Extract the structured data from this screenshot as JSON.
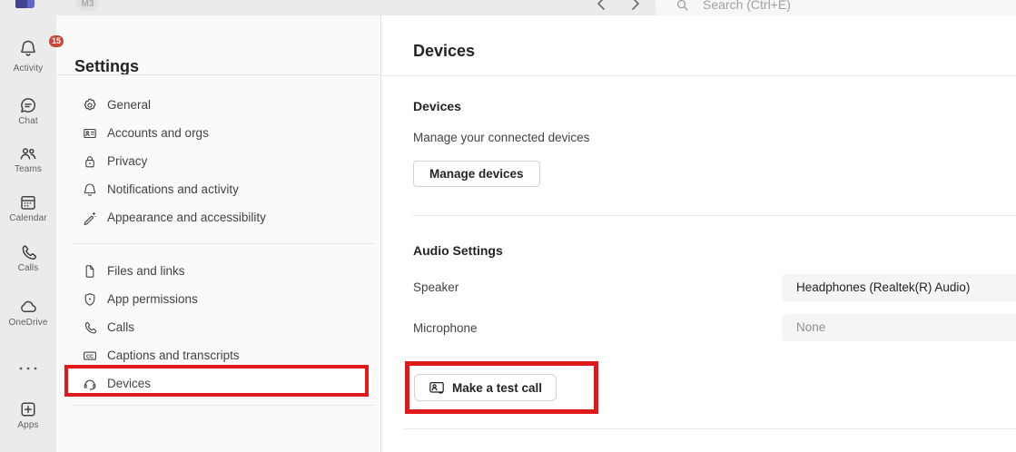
{
  "titlebar": {
    "workspace_badge": "M3",
    "search_placeholder": "Search (Ctrl+E)"
  },
  "rail": {
    "items": [
      {
        "name": "activity",
        "label": "Activity",
        "badge": "15"
      },
      {
        "name": "chat",
        "label": "Chat"
      },
      {
        "name": "teams",
        "label": "Teams"
      },
      {
        "name": "calendar",
        "label": "Calendar"
      },
      {
        "name": "calls",
        "label": "Calls"
      },
      {
        "name": "onedrive",
        "label": "OneDrive"
      },
      {
        "name": "more",
        "label": ""
      },
      {
        "name": "apps",
        "label": "Apps"
      }
    ]
  },
  "sidebar": {
    "title": "Settings",
    "groups": [
      {
        "items": [
          {
            "label": "General",
            "icon": "gear-icon"
          },
          {
            "label": "Accounts and orgs",
            "icon": "id-card-icon"
          },
          {
            "label": "Privacy",
            "icon": "lock-icon"
          },
          {
            "label": "Notifications and activity",
            "icon": "bell-icon"
          },
          {
            "label": "Appearance and accessibility",
            "icon": "pen-sparkle-icon"
          }
        ]
      },
      {
        "items": [
          {
            "label": "Files and links",
            "icon": "document-icon"
          },
          {
            "label": "App permissions",
            "icon": "shield-icon"
          },
          {
            "label": "Calls",
            "icon": "phone-icon"
          },
          {
            "label": "Captions and transcripts",
            "icon": "captions-icon"
          },
          {
            "label": "Devices",
            "icon": "headset-icon",
            "selected": true
          }
        ]
      }
    ]
  },
  "main": {
    "title": "Devices",
    "devices_section": {
      "heading": "Devices",
      "description": "Manage your connected devices",
      "manage_button": "Manage devices"
    },
    "audio_section": {
      "heading": "Audio Settings",
      "speaker_label": "Speaker",
      "speaker_value": "Headphones (Realtek(R) Audio)",
      "microphone_label": "Microphone",
      "microphone_value": "None",
      "test_call_button": "Make a test call"
    }
  },
  "colors": {
    "annotation_red": "#e01a1a",
    "activity_badge": "#c74634",
    "rail_bg": "#ebebeb",
    "sidebar_bg": "#fafafa"
  }
}
